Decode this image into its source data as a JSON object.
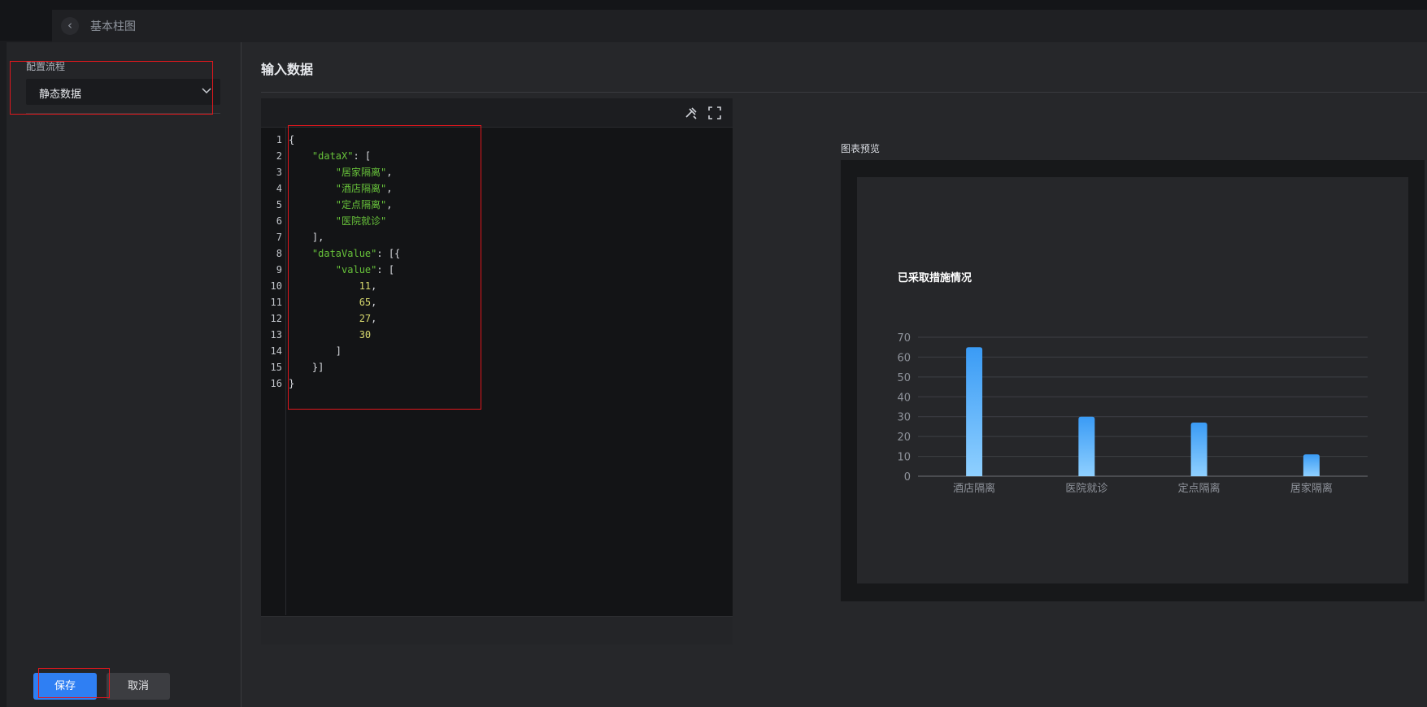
{
  "header": {
    "back_icon": "chevron-left-icon",
    "title": "基本柱图"
  },
  "sidebar": {
    "flow_label": "配置流程",
    "select_value": "静态数据",
    "save_label": "保存",
    "cancel_label": "取消"
  },
  "main": {
    "title": "输入数据",
    "preview_label": "图表预览"
  },
  "editor": {
    "tool_icons": [
      "format-icon",
      "fullscreen-icon"
    ],
    "lines": [
      {
        "n": "1",
        "parts": [
          {
            "t": "{",
            "c": "p"
          }
        ]
      },
      {
        "n": "2",
        "parts": [
          {
            "t": "    \"dataX\"",
            "c": "key"
          },
          {
            "t": ": [",
            "c": "p"
          }
        ]
      },
      {
        "n": "3",
        "parts": [
          {
            "t": "        \"居家隔离\"",
            "c": "str"
          },
          {
            "t": ",",
            "c": "p"
          }
        ]
      },
      {
        "n": "4",
        "parts": [
          {
            "t": "        \"酒店隔离\"",
            "c": "str"
          },
          {
            "t": ",",
            "c": "p"
          }
        ]
      },
      {
        "n": "5",
        "parts": [
          {
            "t": "        \"定点隔离\"",
            "c": "str"
          },
          {
            "t": ",",
            "c": "p"
          }
        ]
      },
      {
        "n": "6",
        "parts": [
          {
            "t": "        \"医院就诊\"",
            "c": "str"
          }
        ]
      },
      {
        "n": "7",
        "parts": [
          {
            "t": "    ],",
            "c": "p"
          }
        ]
      },
      {
        "n": "8",
        "parts": [
          {
            "t": "    \"dataValue\"",
            "c": "key"
          },
          {
            "t": ": [{",
            "c": "p"
          }
        ]
      },
      {
        "n": "9",
        "parts": [
          {
            "t": "        \"value\"",
            "c": "key"
          },
          {
            "t": ": [",
            "c": "p"
          }
        ]
      },
      {
        "n": "10",
        "parts": [
          {
            "t": "            11",
            "c": "num"
          },
          {
            "t": ",",
            "c": "p"
          }
        ]
      },
      {
        "n": "11",
        "parts": [
          {
            "t": "            65",
            "c": "num"
          },
          {
            "t": ",",
            "c": "p"
          }
        ]
      },
      {
        "n": "12",
        "parts": [
          {
            "t": "            27",
            "c": "num"
          },
          {
            "t": ",",
            "c": "p"
          }
        ]
      },
      {
        "n": "13",
        "parts": [
          {
            "t": "            30",
            "c": "num"
          }
        ]
      },
      {
        "n": "14",
        "parts": [
          {
            "t": "        ]",
            "c": "p"
          }
        ]
      },
      {
        "n": "15",
        "parts": [
          {
            "t": "    }]",
            "c": "p"
          }
        ]
      },
      {
        "n": "16",
        "parts": [
          {
            "t": "}",
            "c": "p"
          }
        ]
      }
    ]
  },
  "colors": {
    "accent": "#2f7ff3",
    "bar_top": "#3a9bf5",
    "bar_bottom": "#8fd0ff",
    "annotation": "#e0171d"
  },
  "chart_data": {
    "type": "bar",
    "title": "已采取措施情况",
    "categories": [
      "酒店隔离",
      "医院就诊",
      "定点隔离",
      "居家隔离"
    ],
    "values": [
      65,
      30,
      27,
      11
    ],
    "xlabel": "",
    "ylabel": "",
    "ylim": [
      0,
      70
    ],
    "yticks": [
      0,
      10,
      20,
      30,
      40,
      50,
      60,
      70
    ],
    "grid": true,
    "legend": "none"
  }
}
